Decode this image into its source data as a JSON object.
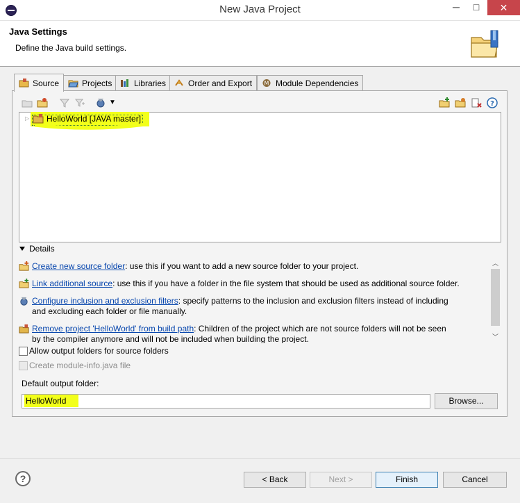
{
  "window": {
    "title": "New Java Project",
    "minimize": "─",
    "maximize": "□",
    "close": "✕"
  },
  "banner": {
    "title": "Java Settings",
    "description": "Define the Java build settings."
  },
  "tabs": [
    {
      "label": "Source",
      "icon": "source-folder-icon"
    },
    {
      "label": "Projects",
      "icon": "projects-icon"
    },
    {
      "label": "Libraries",
      "icon": "libraries-icon"
    },
    {
      "label": "Order and Export",
      "icon": "order-export-icon"
    },
    {
      "label": "Module Dependencies",
      "icon": "module-icon"
    }
  ],
  "tree": {
    "items": [
      {
        "label": "HelloWorld [JAVA master]",
        "highlighted": true
      }
    ]
  },
  "details": {
    "label": "Details",
    "rows": [
      {
        "link": "Create new source folder",
        "text": ": use this if you want to add a new source folder to your project."
      },
      {
        "link": "Link additional source",
        "text": ": use this if you have a folder in the file system that should be used as additional source folder."
      },
      {
        "link": "Configure inclusion and exclusion filters",
        "text": ": specify patterns to the inclusion and exclusion filters instead of including",
        "text2": "and excluding each folder or file manually."
      },
      {
        "link": "Remove project 'HelloWorld' from build path",
        "text": ": Children of the project which are not source folders will not be seen",
        "text2": "by the compiler anymore and will not be included when building the project."
      }
    ]
  },
  "options": {
    "allow_output": "Allow output folders for source folders",
    "create_module_info": "Create module-info.java file"
  },
  "output": {
    "label": "Default output folder:",
    "value": "HelloWorld",
    "browse": "Browse..."
  },
  "buttons": {
    "back": "< Back",
    "next": "Next >",
    "finish": "Finish",
    "cancel": "Cancel"
  },
  "colors": {
    "highlight": "#f2ff1a",
    "link": "#0645ad",
    "close_button": "#c7454b"
  }
}
